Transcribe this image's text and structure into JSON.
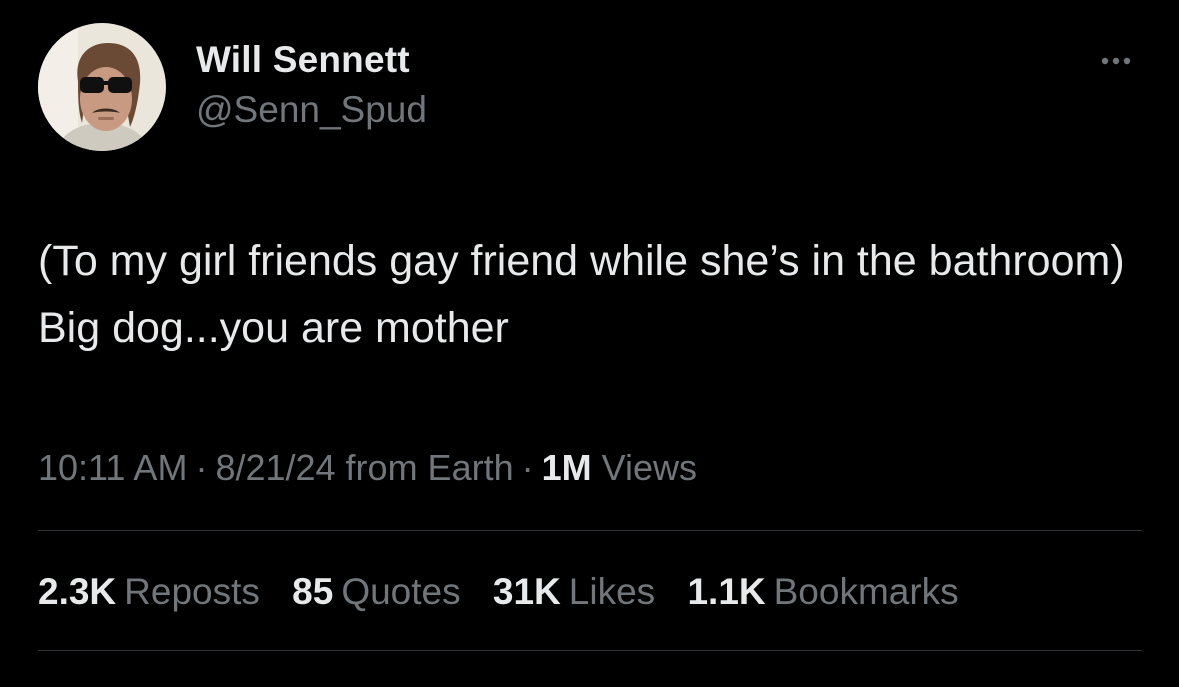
{
  "author": {
    "display_name": "Will Sennett",
    "handle": "@Senn_Spud"
  },
  "tweet": {
    "text": "(To my girl friends gay friend while she’s in the bathroom) Big dog...you are mother"
  },
  "meta": {
    "time": "10:11 AM",
    "separator": "·",
    "date_source": "8/21/24 from Earth",
    "views_count": "1M",
    "views_label": "Views"
  },
  "stats": {
    "reposts": {
      "count": "2.3K",
      "label": "Reposts"
    },
    "quotes": {
      "count": "85",
      "label": "Quotes"
    },
    "likes": {
      "count": "31K",
      "label": "Likes"
    },
    "bookmarks": {
      "count": "1.1K",
      "label": "Bookmarks"
    }
  },
  "icons": {
    "more": "more-horizontal-icon"
  },
  "colors": {
    "background": "#000000",
    "primary_text": "#e7e9ea",
    "secondary_text": "#71767b",
    "divider": "#2f3336"
  }
}
